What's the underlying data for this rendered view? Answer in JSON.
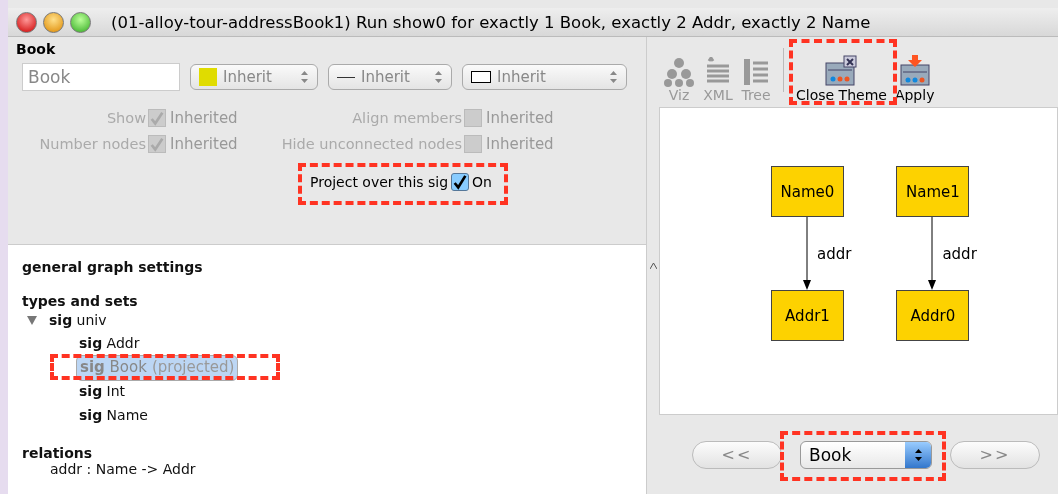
{
  "window": {
    "title": "(01-alloy-tour-addressBook1) Run show0 for exactly 1 Book, exactly 2 Addr, exactly 2 Name"
  },
  "editor": {
    "heading": "Book",
    "name_value": "Book",
    "selects": [
      {
        "kind": "color",
        "label": "Inherit",
        "color": "#e0dc00"
      },
      {
        "kind": "line",
        "label": "Inherit"
      },
      {
        "kind": "shape",
        "label": "Inherit"
      }
    ],
    "options": [
      {
        "label": "Show",
        "checked": true,
        "value_label": "Inherited"
      },
      {
        "label": "Align members",
        "checked": false,
        "value_label": "Inherited"
      },
      {
        "label": "Number nodes",
        "checked": true,
        "value_label": "Inherited"
      },
      {
        "label": "Hide unconnected nodes",
        "checked": false,
        "value_label": "Inherited"
      }
    ],
    "project": {
      "label": "Project over this sig",
      "checked": true,
      "value_label": "On"
    }
  },
  "settings": {
    "general": "general graph settings",
    "types_heading": "types and sets",
    "types": [
      {
        "keyword": "sig",
        "name": "univ",
        "expanded": true,
        "selected": false,
        "children": [
          {
            "keyword": "sig",
            "name": "Addr",
            "selected": false
          },
          {
            "keyword": "sig",
            "name": "Book",
            "note": "(projected)",
            "selected": true
          },
          {
            "keyword": "sig",
            "name": "Int",
            "selected": false
          },
          {
            "keyword": "sig",
            "name": "Name",
            "selected": false
          }
        ]
      }
    ],
    "relations_heading": "relations",
    "relations": [
      "addr : Name -> Addr"
    ]
  },
  "toolbar": [
    {
      "kind": "viz",
      "label": "Viz",
      "disabled": true
    },
    {
      "kind": "xml",
      "label": "XML",
      "disabled": true
    },
    {
      "kind": "tree",
      "label": "Tree",
      "disabled": true
    },
    {
      "kind": "close_theme",
      "label": "Close Theme",
      "disabled": false
    },
    {
      "kind": "apply",
      "label": "Apply",
      "disabled": false
    }
  ],
  "graph": {
    "columns": [
      {
        "top": "Name0",
        "edge": "addr",
        "bottom": "Addr1"
      },
      {
        "top": "Name1",
        "edge": "addr",
        "bottom": "Addr0"
      }
    ]
  },
  "nav": {
    "prev": "<<",
    "projection": "Book",
    "next": ">>"
  }
}
